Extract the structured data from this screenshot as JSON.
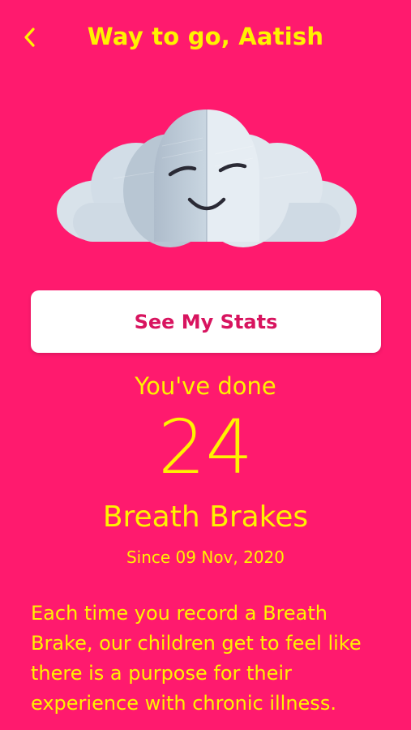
{
  "header": {
    "title": "Way to go, Aatish",
    "back_icon": "chevron-left-icon"
  },
  "illustration": {
    "name": "smiling-cloud",
    "mood": "content"
  },
  "stats_button": {
    "label": "See My Stats"
  },
  "summary": {
    "label": "You've done",
    "count": "24",
    "unit": "Breath Brakes",
    "since": "Since 09 Nov, 2020"
  },
  "message": {
    "text": "Each time you record a Breath Brake, our children get to feel like there is a purpose for their experience with chronic illness."
  },
  "colors": {
    "background": "#ff1a6e",
    "accent_text": "#fff200",
    "button_background": "#ffffff",
    "button_text": "#d8145f",
    "cloud_light": "#dde6ee",
    "cloud_mid": "#c4d1dd",
    "cloud_shadow": "#aebccb"
  }
}
